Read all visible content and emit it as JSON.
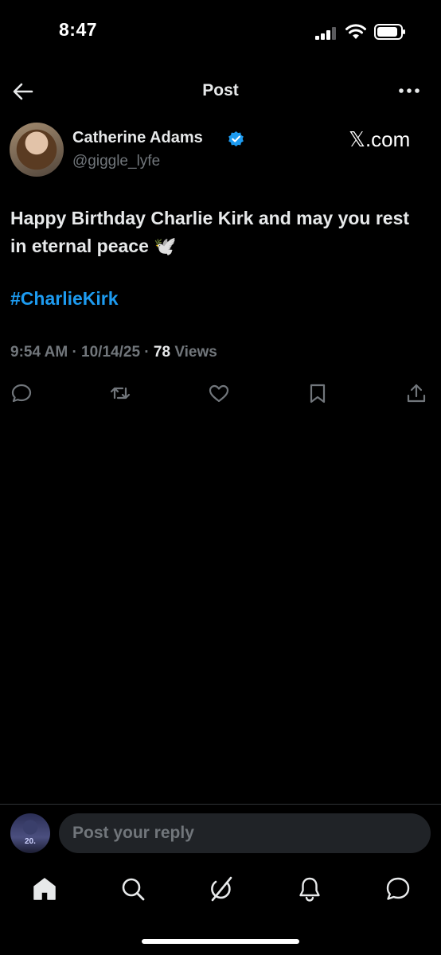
{
  "status_bar": {
    "time": "8:47"
  },
  "header": {
    "title": "Post"
  },
  "author": {
    "name": "Catherine Adams",
    "handle": "@giggle_lyfe",
    "verified": true
  },
  "source_mark": "𝕏.com",
  "post": {
    "text": "Happy Birthday Charlie Kirk and may you rest in eternal peace ",
    "emoji": "🕊️",
    "hashtag": "#CharlieKirk",
    "time": "9:54 AM",
    "date": "10/14/25",
    "separator": "·",
    "views_count": "78",
    "views_label": "Views"
  },
  "actions": [
    "reply-icon",
    "repost-icon",
    "like-icon",
    "bookmark-icon",
    "share-icon"
  ],
  "reply": {
    "placeholder": "Post your reply",
    "avatar_text": "20."
  },
  "bottom_nav": [
    "home-icon",
    "search-icon",
    "grok-icon",
    "notifications-icon",
    "messages-icon"
  ],
  "colors": {
    "background": "#000000",
    "text": "#e7e9ea",
    "muted": "#71767b",
    "accent": "#1d9bf0"
  }
}
